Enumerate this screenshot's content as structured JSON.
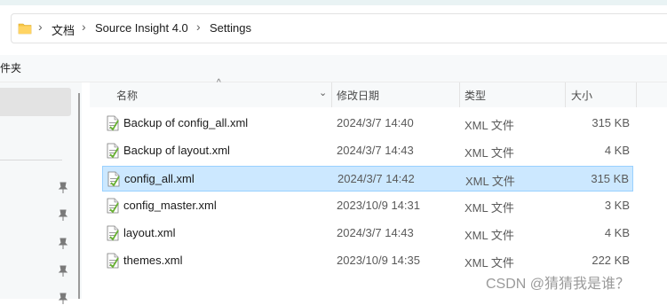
{
  "breadcrumb": [
    "文档",
    "Source Insight 4.0",
    "Settings"
  ],
  "command_bar": {
    "label": "件夹"
  },
  "columns": {
    "name": "名称",
    "modified": "修改日期",
    "type": "类型",
    "size": "大小"
  },
  "files": [
    {
      "name": "Backup of config_all.xml",
      "modified": "2024/3/7 14:40",
      "type": "XML 文件",
      "size": "315 KB",
      "selected": false
    },
    {
      "name": "Backup of layout.xml",
      "modified": "2024/3/7 14:43",
      "type": "XML 文件",
      "size": "4 KB",
      "selected": false
    },
    {
      "name": "config_all.xml",
      "modified": "2024/3/7 14:42",
      "type": "XML 文件",
      "size": "315 KB",
      "selected": true
    },
    {
      "name": "config_master.xml",
      "modified": "2023/10/9 14:31",
      "type": "XML 文件",
      "size": "3 KB",
      "selected": false
    },
    {
      "name": "layout.xml",
      "modified": "2024/3/7 14:43",
      "type": "XML 文件",
      "size": "4 KB",
      "selected": false
    },
    {
      "name": "themes.xml",
      "modified": "2023/10/9 14:35",
      "type": "XML 文件",
      "size": "222 KB",
      "selected": false
    }
  ],
  "watermark": "CSDN @猜猜我是谁？",
  "colors": {
    "selection_bg": "#cce8ff",
    "selection_border": "#99d1ff",
    "folder": "#f6c544"
  },
  "icons": {
    "folder": "folder-icon",
    "xml_file": "xml-file-icon",
    "pin": "pin-icon"
  }
}
